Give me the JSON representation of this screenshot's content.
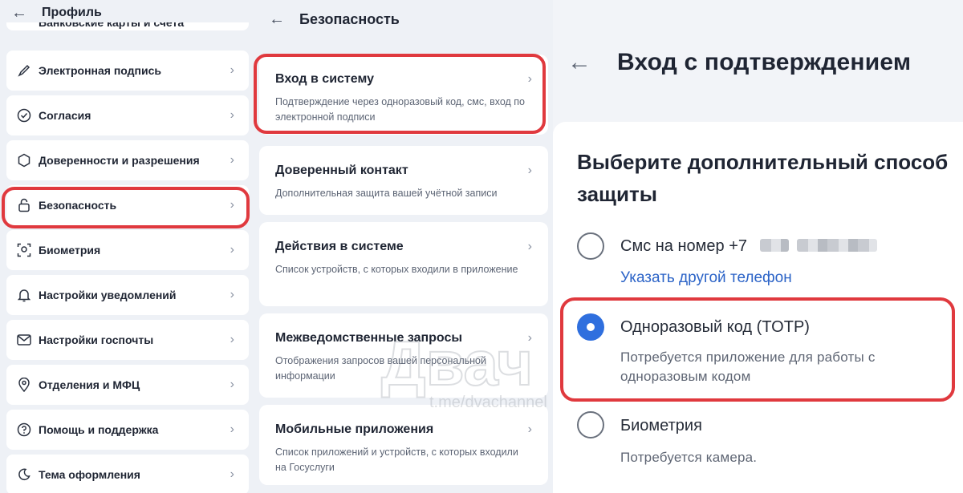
{
  "profile": {
    "title": "Профиль",
    "cut_item": "Банковские карты и счета",
    "items": [
      {
        "label": "Электронная подпись",
        "icon": "pen-icon"
      },
      {
        "label": "Согласия",
        "icon": "check-circle-icon"
      },
      {
        "label": "Доверенности и разрешения",
        "icon": "hexagon-icon"
      },
      {
        "label": "Безопасность",
        "icon": "lock-icon"
      },
      {
        "label": "Биометрия",
        "icon": "face-scan-icon"
      },
      {
        "label": "Настройки уведомлений",
        "icon": "bell-icon"
      },
      {
        "label": "Настройки госпочты",
        "icon": "mail-icon"
      },
      {
        "label": "Отделения и МФЦ",
        "icon": "location-pin-icon"
      },
      {
        "label": "Помощь и поддержка",
        "icon": "help-icon"
      },
      {
        "label": "Тема оформления",
        "icon": "moon-icon"
      }
    ]
  },
  "security": {
    "title": "Безопасность",
    "cards": [
      {
        "title": "Вход в систему",
        "desc": "Подтверждение через одноразовый код, смс, вход по электронной подписи"
      },
      {
        "title": "Доверенный контакт",
        "desc": "Дополнительная защита вашей учётной записи"
      },
      {
        "title": "Действия в системе",
        "desc": "Список устройств, с которых входили в приложение"
      },
      {
        "title": "Межведомственные запросы",
        "desc": "Отображения запросов вашей персональной информации"
      },
      {
        "title": "Мобильные приложения",
        "desc": "Список приложений и устройств, с которых входили на Госуслуги"
      }
    ]
  },
  "login_confirm": {
    "title": "Вход с подтверждением",
    "question": "Выберите дополнительный способ защиты",
    "options": [
      {
        "label": "Смс на номер +7",
        "link": "Указать другой телефон",
        "selected": false
      },
      {
        "label": "Одноразовый код (TOTP)",
        "sub": "Потребуется приложение для работы с одноразовым кодом",
        "selected": true
      },
      {
        "label": "Биометрия",
        "sub": "Потребуется камера.",
        "selected": false
      }
    ]
  },
  "watermark": {
    "text": "Двач",
    "handle": "t.me/dvachannel"
  },
  "colors": {
    "highlight": "#e0393e",
    "accent": "#2f6fde",
    "link": "#2b63c7"
  }
}
